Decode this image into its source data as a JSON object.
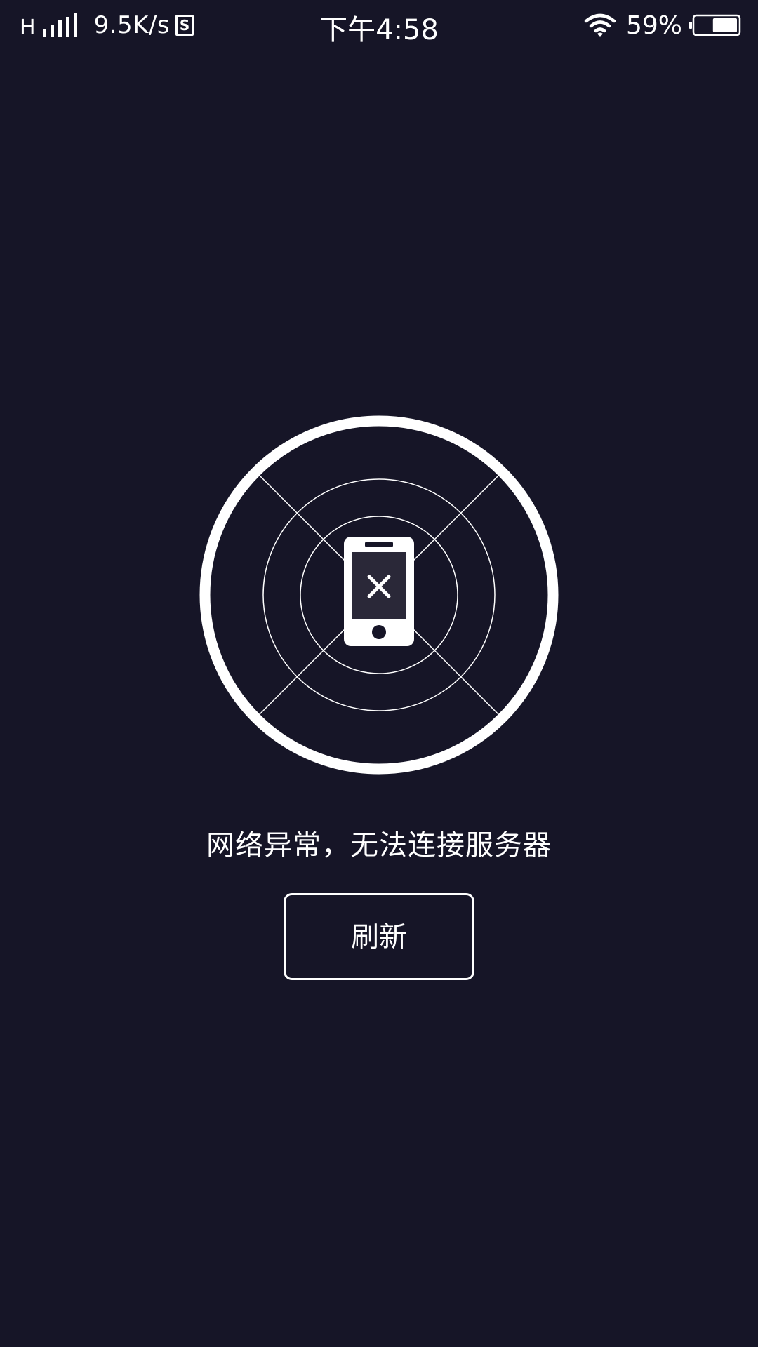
{
  "status_bar": {
    "network_type": "H",
    "speed": "9.5K/s",
    "sim_letter": "S",
    "time": "下午4:58",
    "battery_percent_text": "59%",
    "battery_level": 0.59,
    "signal_icon": "signal-bars-icon",
    "wifi_icon": "wifi-icon",
    "battery_icon": "battery-icon"
  },
  "main": {
    "illustration_icon": "phone-disconnected-icon",
    "error_message": "网络异常，无法连接服务器",
    "refresh_label": "刷新"
  },
  "colors": {
    "background": "#161527",
    "foreground": "#ffffff",
    "phone_screen": "#2a2838"
  }
}
